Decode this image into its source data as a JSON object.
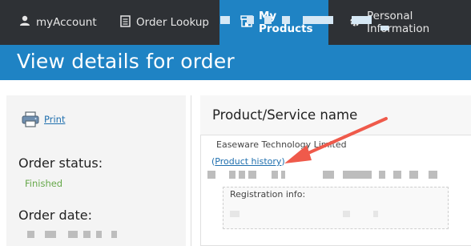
{
  "nav": {
    "tabs": [
      {
        "label": "myAccount",
        "icon": "user-icon",
        "active": false
      },
      {
        "label": "Order Lookup",
        "icon": "document-icon",
        "active": false
      },
      {
        "label": "My Products",
        "icon": "store-icon",
        "active": true
      },
      {
        "label": "Personal Information",
        "icon": "gear-icon",
        "active": false
      }
    ]
  },
  "header": {
    "title": "View details for order"
  },
  "sidebar": {
    "print_label": "Print",
    "order_status_label": "Order status:",
    "order_status_value": "Finished",
    "order_date_label": "Order date:"
  },
  "product": {
    "column_title": "Product/Service name",
    "name": "Easeware Technology Limited",
    "history_link": "Product history",
    "history_open": "(",
    "history_close": ")",
    "registration_label": "Registration info:"
  },
  "colors": {
    "nav_bg": "#2e3135",
    "accent_blue": "#1f83c4",
    "status_green": "#66a84a",
    "annotation_arrow": "#ef5a4b"
  }
}
